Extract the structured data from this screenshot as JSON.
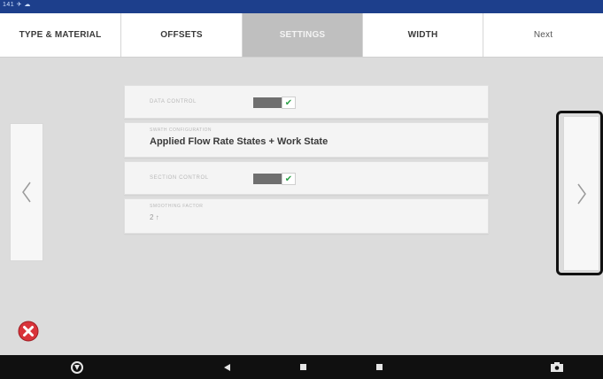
{
  "status_bar": {
    "text": "141 ✈ ☁"
  },
  "tabs": [
    {
      "label": "TYPE & MATERIAL",
      "active": false
    },
    {
      "label": "OFFSETS",
      "active": false
    },
    {
      "label": "SETTINGS",
      "active": true
    },
    {
      "label": "WIDTH",
      "active": false
    },
    {
      "label": "Next",
      "active": false
    }
  ],
  "settings": {
    "data_control_label": "DATA CONTROL",
    "data_control_on": true,
    "display_caption": "SWATH CONFIGURATION",
    "display_value": "Applied Flow Rate States + Work State",
    "section_control_label": "SECTION CONTROL",
    "section_control_on": true,
    "smoothing_caption": "SMOOTHING FACTOR",
    "smoothing_value": "2 ↑"
  },
  "colors": {
    "status_bar": "#1d3f8c",
    "active_tab": "#bfbfbf",
    "toggle_check": "#2ea24a",
    "cancel_red": "#d9333a"
  },
  "icons": {
    "left_arrow": "chevron-left-icon",
    "right_arrow": "chevron-right-icon",
    "cancel": "cancel-icon",
    "home": "trimble-logo-icon",
    "back": "back-triangle-icon",
    "home_square": "home-icon",
    "recents": "recents-icon",
    "screenshot": "camera-icon"
  }
}
